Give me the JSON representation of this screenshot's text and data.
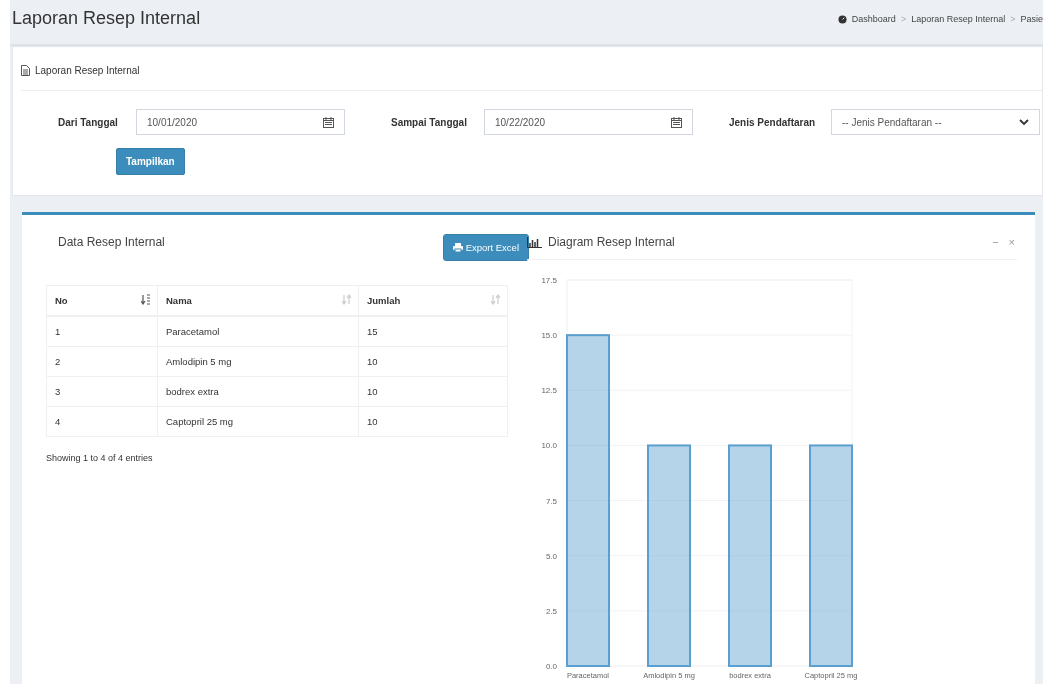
{
  "header": {
    "title": "Laporan Resep Internal",
    "breadcrumb": [
      {
        "kind": "link",
        "text": "Dashboard"
      },
      {
        "kind": "separator",
        "text": ">"
      },
      {
        "kind": "link",
        "text": "Laporan Resep Internal"
      },
      {
        "kind": "separator",
        "text": ">"
      },
      {
        "kind": "link",
        "text": "Pasie"
      }
    ]
  },
  "filter_box": {
    "title": "Laporan Resep Internal",
    "fields": [
      {
        "kind": "date",
        "label": "Dari Tanggal",
        "value": "10/01/2020"
      },
      {
        "kind": "date",
        "label": "Sampai Tanggal",
        "value": "10/22/2020"
      },
      {
        "kind": "select",
        "label": "Jenis Pendaftaran",
        "value": "-- Jenis Pendaftaran --"
      }
    ],
    "button": "Tampilkan"
  },
  "data_panel": {
    "title": "Data Resep Internal",
    "export_button": "Export Excel",
    "columns": [
      {
        "label": "No",
        "sorted": true
      },
      {
        "label": "Nama",
        "sorted": false
      },
      {
        "label": "Jumlah",
        "sorted": false
      }
    ],
    "rows": [
      [
        "1",
        "Paracetamol",
        "15"
      ],
      [
        "2",
        "Amlodipin 5 mg",
        "10"
      ],
      [
        "3",
        "bodrex extra",
        "10"
      ],
      [
        "4",
        "Captopril 25 mg",
        "10"
      ]
    ],
    "info": "Showing 1 to 4 of 4 entries"
  },
  "chart_panel": {
    "title": "Diagram Resep Internal",
    "tools": [
      "−",
      "×"
    ],
    "chart_data": {
      "type": "bar",
      "grid": true,
      "categories": [
        "Paracetamol",
        "Amlodipin 5 mg",
        "bodrex extra",
        "Captopril 25 mg"
      ],
      "series": [
        {
          "color": "#5a9fcf",
          "values": [
            15,
            10,
            10,
            10
          ]
        }
      ],
      "ylim": [
        0,
        17.5
      ],
      "yticks": [
        {
          "value": 0,
          "label": "0.0"
        },
        {
          "value": 2.5,
          "label": "2.5"
        },
        {
          "value": 5,
          "label": "5.0"
        },
        {
          "value": 7.5,
          "label": "7.5"
        },
        {
          "value": 10,
          "label": "10.0"
        },
        {
          "value": 12.5,
          "label": "12.5"
        },
        {
          "value": 15,
          "label": "15.0"
        },
        {
          "value": 17.5,
          "label": "17.5"
        }
      ]
    }
  }
}
